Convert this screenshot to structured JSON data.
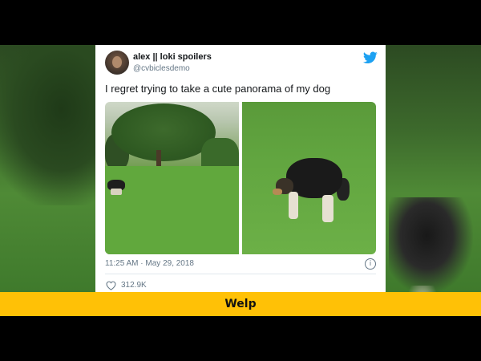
{
  "tweet": {
    "author_name": "alex || loki spoilers",
    "author_handle": "@cvbiclesdemo",
    "text": "I regret trying to take a cute panorama of my dog",
    "timestamp": "11:25 AM · May 29, 2018",
    "likes": "312.9K",
    "icons": {
      "bird": "twitter-bird-icon",
      "info": "info-icon",
      "heart": "heart-icon"
    },
    "info_glyph": "i",
    "brand_color": "#1da1f2"
  },
  "caption": {
    "text": "Welp",
    "background_color": "#ffc106"
  }
}
